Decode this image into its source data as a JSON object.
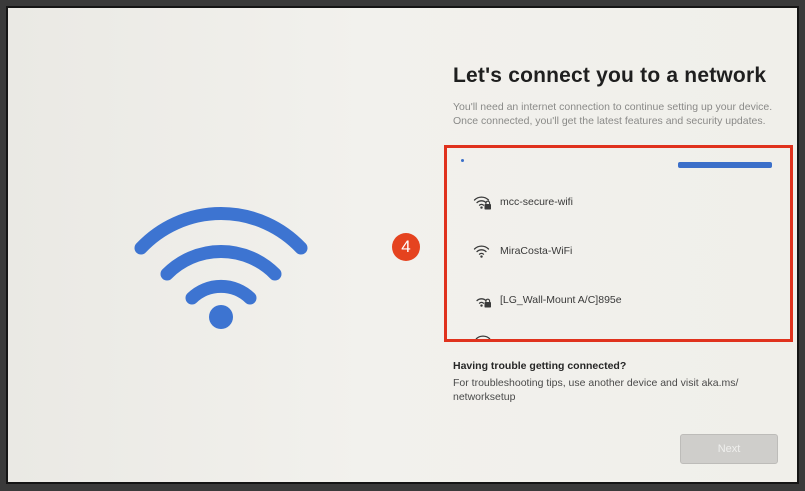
{
  "page": {
    "title": "Let's connect you to a network",
    "subtitle": "You'll need an internet connection to continue setting up your device. Once connected, you'll get the latest features and security updates."
  },
  "step_badge": "4",
  "networks": [
    {
      "name": "mcc-secure-wifi",
      "icon": "wifi-lock-icon",
      "secured": true
    },
    {
      "name": "MiraCosta-WiFi",
      "icon": "wifi-icon",
      "secured": false
    },
    {
      "name": "[LG_Wall-Mount A/C]895e",
      "icon": "wifi-lock-icon",
      "secured": true
    }
  ],
  "help": {
    "title": "Having trouble getting connected?",
    "text": "For troubleshooting tips, use another device and visit aka.ms/ networksetup"
  },
  "buttons": {
    "next_label": "Next"
  },
  "colors": {
    "wifi_hero": "#3d74d1",
    "highlight_border": "#e0321d",
    "badge": "#e5431f",
    "scroll_indicator": "#3b6fc9",
    "button_disabled": "#cfcecb"
  }
}
